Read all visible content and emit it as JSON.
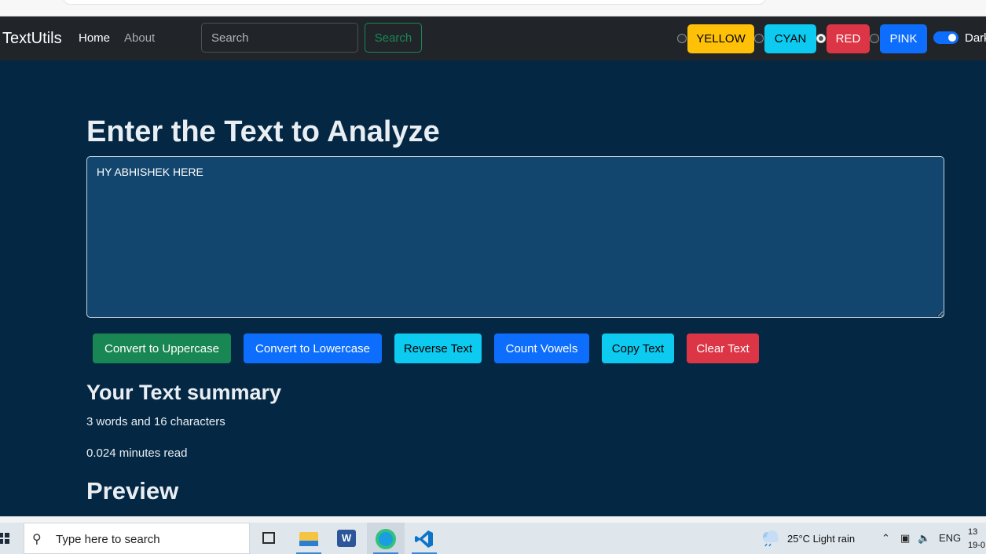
{
  "navbar": {
    "brand": "TextUtils",
    "links": [
      "Home",
      "About"
    ],
    "search_placeholder": "Search",
    "search_button": "Search",
    "theme_buttons": [
      "YELLOW",
      "CYAN",
      "RED",
      "PINK"
    ],
    "selected_theme": "RED",
    "dark_mode_label": "Dark",
    "dark_mode_on": true
  },
  "main": {
    "heading": "Enter the Text to Analyze",
    "textarea_value": "HY ABHISHEK HERE",
    "buttons": [
      "Convert to Uppercase",
      "Convert to Lowercase",
      "Reverse Text",
      "Count Vowels",
      "Copy Text",
      "Clear Text"
    ],
    "summary_title": "Your Text summary",
    "summary_counts": "3 words and 16 characters",
    "summary_read": "0.024 minutes read",
    "preview_title": "Preview"
  },
  "taskbar": {
    "search_text": "Type here to search",
    "weather": "25°C  Light rain",
    "language": "ENG",
    "time": "13",
    "date": "19-0"
  },
  "colors": {
    "navbar": "#212529",
    "page_background": "#042743",
    "textarea_background": "#13466e"
  }
}
